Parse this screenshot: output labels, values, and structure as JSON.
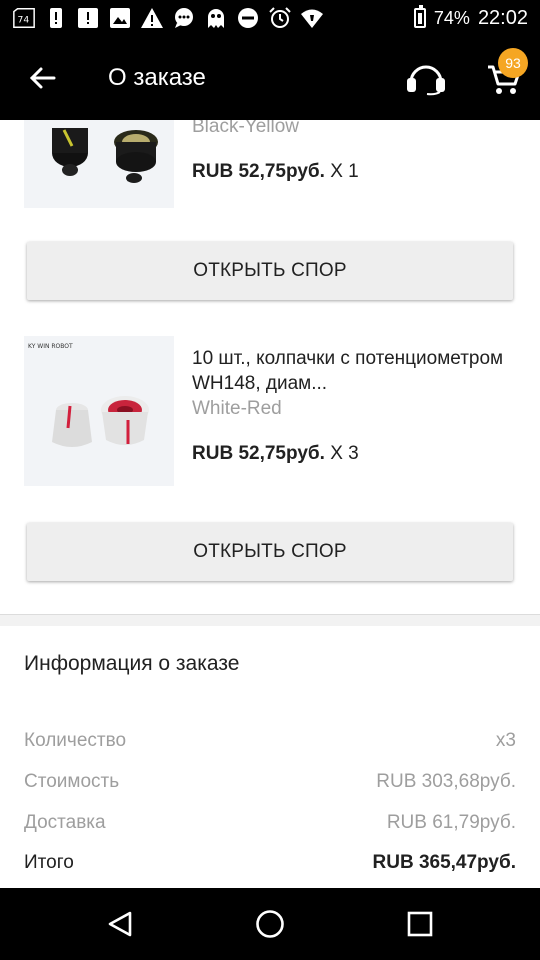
{
  "status_bar": {
    "battery_pct": "74%",
    "time": "22:02",
    "icons": [
      "sim-74-icon",
      "alert-icon",
      "alert-box-icon",
      "image-icon",
      "warning-icon",
      "chat-icon",
      "ghost-icon",
      "do-not-disturb-icon",
      "alarm-icon",
      "wifi-icon",
      "battery-icon"
    ]
  },
  "app_bar": {
    "title": "О заказе",
    "cart_count": "93",
    "icons": {
      "back": "arrow-back-icon",
      "support": "headset-icon",
      "cart": "cart-icon"
    }
  },
  "items": [
    {
      "name": "",
      "variant": "Black-Yellow",
      "price": "RUB 52,75руб.",
      "qty": " X 1",
      "dispute_label": "ОТКРЫТЬ СПОР"
    },
    {
      "brand": "KY WIN ROBOT",
      "name": "10 шт., колпачки с потенциометром WH148, диам...",
      "variant": "White-Red",
      "price": "RUB 52,75руб.",
      "qty": " X 3",
      "dispute_label": "ОТКРЫТЬ СПОР"
    }
  ],
  "order_info": {
    "title": "Информация о заказе",
    "rows": [
      {
        "label": "Количество",
        "value": "x3"
      },
      {
        "label": "Стоимость",
        "value": "RUB 303,68руб."
      },
      {
        "label": "Доставка",
        "value": "RUB 61,79руб."
      },
      {
        "label": "Итого",
        "value": "RUB 365,47руб."
      }
    ]
  },
  "colors": {
    "badge": "#f5a623",
    "bar": "#000000",
    "button_bg": "#eeeeee",
    "muted_text": "#9e9e9e"
  }
}
